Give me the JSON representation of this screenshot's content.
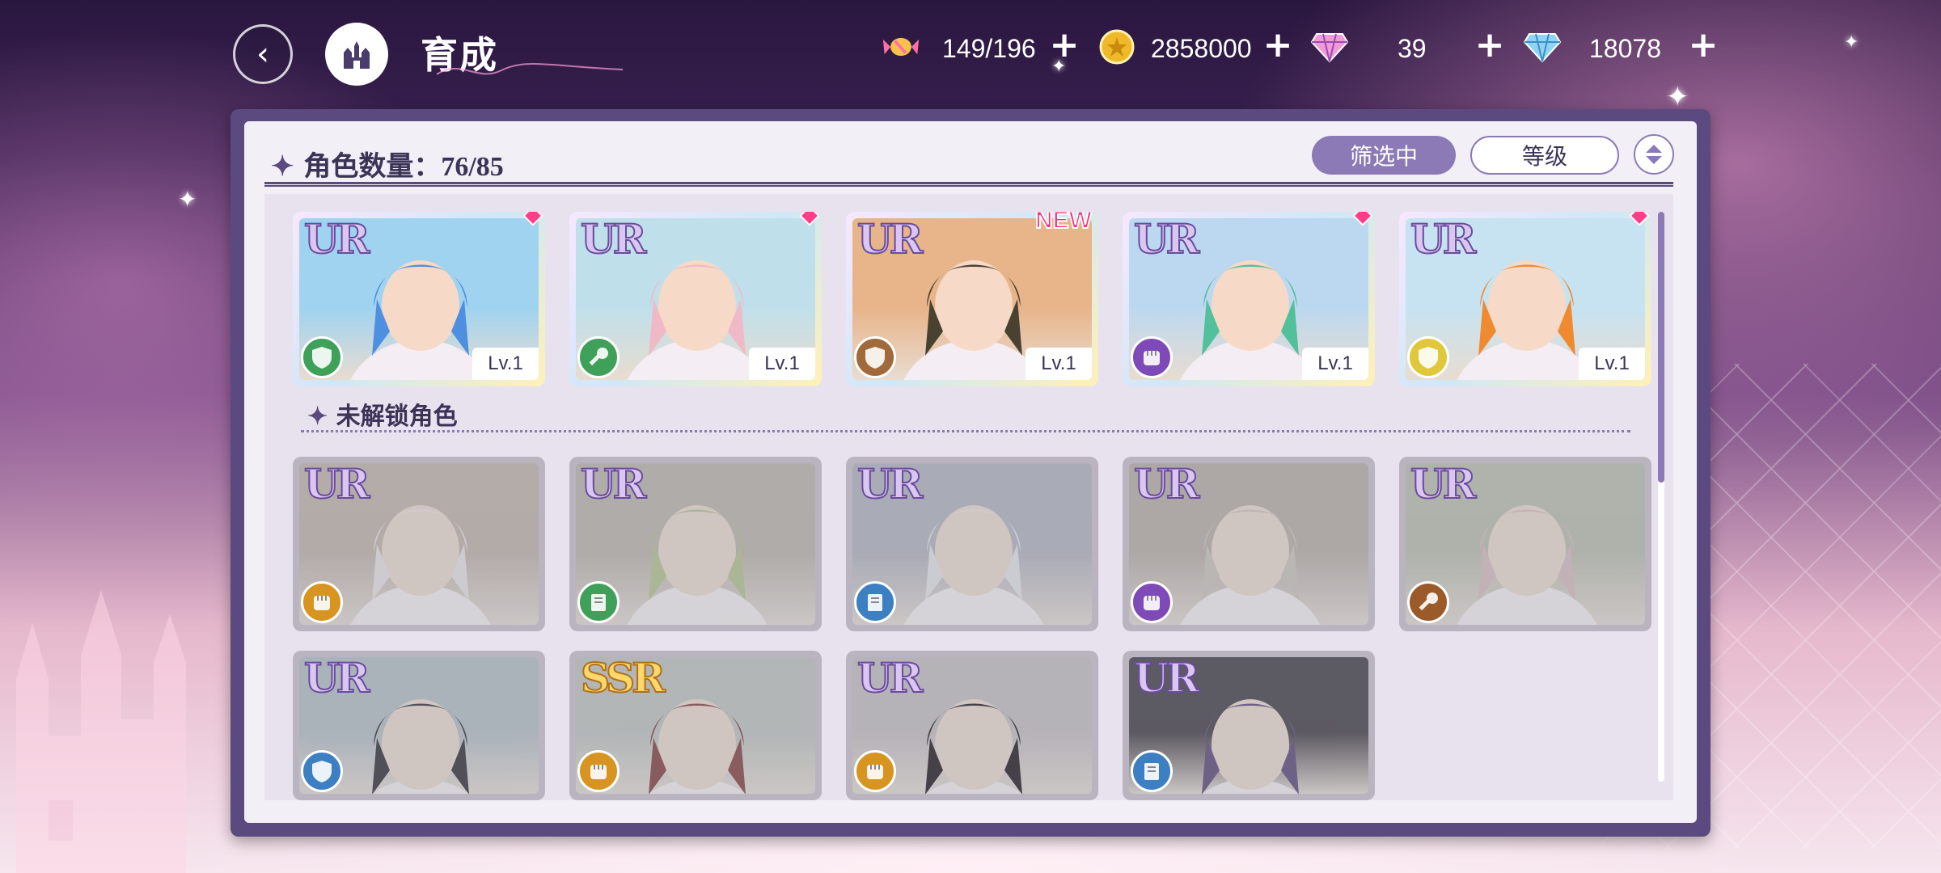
{
  "header": {
    "title": "育成",
    "resources": {
      "stamina": "149/196",
      "coins": "2858000",
      "gems_paid": "39",
      "gems_free": "18078"
    }
  },
  "panel": {
    "count_label": "角色数量：",
    "count_value": "76/85",
    "filter_label": "筛选中",
    "sort_label": "等级",
    "locked_section_label": "未解锁角色"
  },
  "owned_characters": [
    {
      "rarity": "UR",
      "level": "Lv.1",
      "role": "shield",
      "role_color": "#3fa05a",
      "flag": "gem",
      "hair": "#4f8fe0",
      "bg": "#9fd3f0"
    },
    {
      "rarity": "UR",
      "level": "Lv.1",
      "role": "wand",
      "role_color": "#3fa05a",
      "flag": "gem",
      "hair": "#f0b9c8",
      "bg": "#bfe0ea"
    },
    {
      "rarity": "UR",
      "level": "Lv.1",
      "role": "shield",
      "role_color": "#a06a3a",
      "flag": "NEW",
      "hair": "#4a4230",
      "bg": "#e8b48a"
    },
    {
      "rarity": "UR",
      "level": "Lv.1",
      "role": "fist",
      "role_color": "#7e4ab8",
      "flag": "gem",
      "hair": "#52c09a",
      "bg": "#bcd8f0"
    },
    {
      "rarity": "UR",
      "level": "Lv.1",
      "role": "shield",
      "role_color": "#e0c83a",
      "flag": "gem",
      "hair": "#f08a30",
      "bg": "#c7e3f2"
    }
  ],
  "locked_characters": [
    {
      "rarity": "UR",
      "role": "fist",
      "role_color": "#d89420",
      "hair": "#e8e4ea",
      "bg": "#c9b6a6"
    },
    {
      "rarity": "UR",
      "role": "book",
      "role_color": "#3fa05a",
      "hair": "#a8d060",
      "bg": "#c0b8a8"
    },
    {
      "rarity": "UR",
      "role": "book",
      "role_color": "#3c7fc2",
      "hair": "#e0e6f0",
      "bg": "#aeb8d2"
    },
    {
      "rarity": "UR",
      "role": "fist",
      "role_color": "#7e4ab8",
      "hair": "#cfc6b8",
      "bg": "#bfb2a4"
    },
    {
      "rarity": "UR",
      "role": "wand",
      "role_color": "#9a5a2a",
      "hair": "#f0b9c8",
      "bg": "#b8c4a8"
    },
    {
      "rarity": "UR",
      "role": "shield",
      "role_color": "#3c7fc2",
      "hair": "#3a3848",
      "bg": "#a8c4d6"
    },
    {
      "rarity": "SSR",
      "role": "fist",
      "role_color": "#d89420",
      "hair": "#c03a3a",
      "bg": "#b8c8c4"
    },
    {
      "rarity": "UR",
      "role": "fist",
      "role_color": "#d89420",
      "hair": "#2a2430",
      "bg": "#c8c0cc"
    },
    {
      "rarity": "UR",
      "role": "book",
      "role_color": "#3c7fc2",
      "hair": "#6a48b0",
      "bg": "#4a4458"
    }
  ]
}
